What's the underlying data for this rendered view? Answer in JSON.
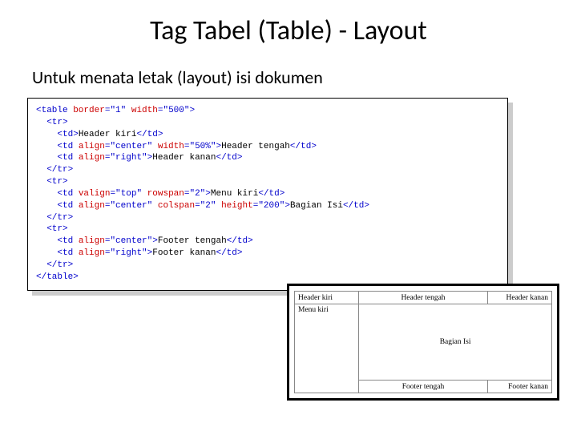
{
  "title": "Tag Tabel (Table) - Layout",
  "subtitle": "Untuk menata letak (layout) isi dokumen",
  "code": {
    "l1a": "<table",
    "l1b": " border",
    "l1c": "=",
    "l1d": "\"1\"",
    "l1e": " width",
    "l1f": "=",
    "l1g": "\"500\"",
    "l1h": ">",
    "l2a": "  <tr>",
    "l3a": "    <td>",
    "l3b": "Header kiri",
    "l3c": "</td>",
    "l4a": "    <td",
    "l4b": " align",
    "l4c": "=",
    "l4d": "\"center\"",
    "l4e": " width",
    "l4f": "=",
    "l4g": "\"50%\"",
    "l4h": ">",
    "l4i": "Header tengah",
    "l4j": "</td>",
    "l5a": "    <td",
    "l5b": " align",
    "l5c": "=",
    "l5d": "\"right\"",
    "l5e": ">",
    "l5f": "Header kanan",
    "l5g": "</td>",
    "l6a": "  </tr>",
    "l7a": "  <tr>",
    "l8a": "    <td",
    "l8b": " valign",
    "l8c": "=",
    "l8d": "\"top\"",
    "l8e": " rowspan",
    "l8f": "=",
    "l8g": "\"2\"",
    "l8h": ">",
    "l8i": "Menu kiri",
    "l8j": "</td>",
    "l9a": "    <td",
    "l9b": " align",
    "l9c": "=",
    "l9d": "\"center\"",
    "l9e": " colspan",
    "l9f": "=",
    "l9g": "\"2\"",
    "l9h": " height",
    "l9i": "=",
    "l9j": "\"200\"",
    "l9k": ">",
    "l9l": "Bagian Isi",
    "l9m": "</td>",
    "l10a": "  </tr>",
    "l11a": "  <tr>",
    "l12a": "    <td",
    "l12b": " align",
    "l12c": "=",
    "l12d": "\"center\"",
    "l12e": ">",
    "l12f": "Footer tengah",
    "l12g": "</td>",
    "l13a": "    <td",
    "l13b": " align",
    "l13c": "=",
    "l13d": "\"right\"",
    "l13e": ">",
    "l13f": "Footer kanan",
    "l13g": "</td>",
    "l14a": "  </tr>",
    "l15a": "</table>"
  },
  "render": {
    "header_left": "Header kiri",
    "header_center": "Header tengah",
    "header_right": "Header kanan",
    "menu_left": "Menu kiri",
    "content": "Bagian Isi",
    "footer_center": "Footer tengah",
    "footer_right": "Footer kanan"
  }
}
